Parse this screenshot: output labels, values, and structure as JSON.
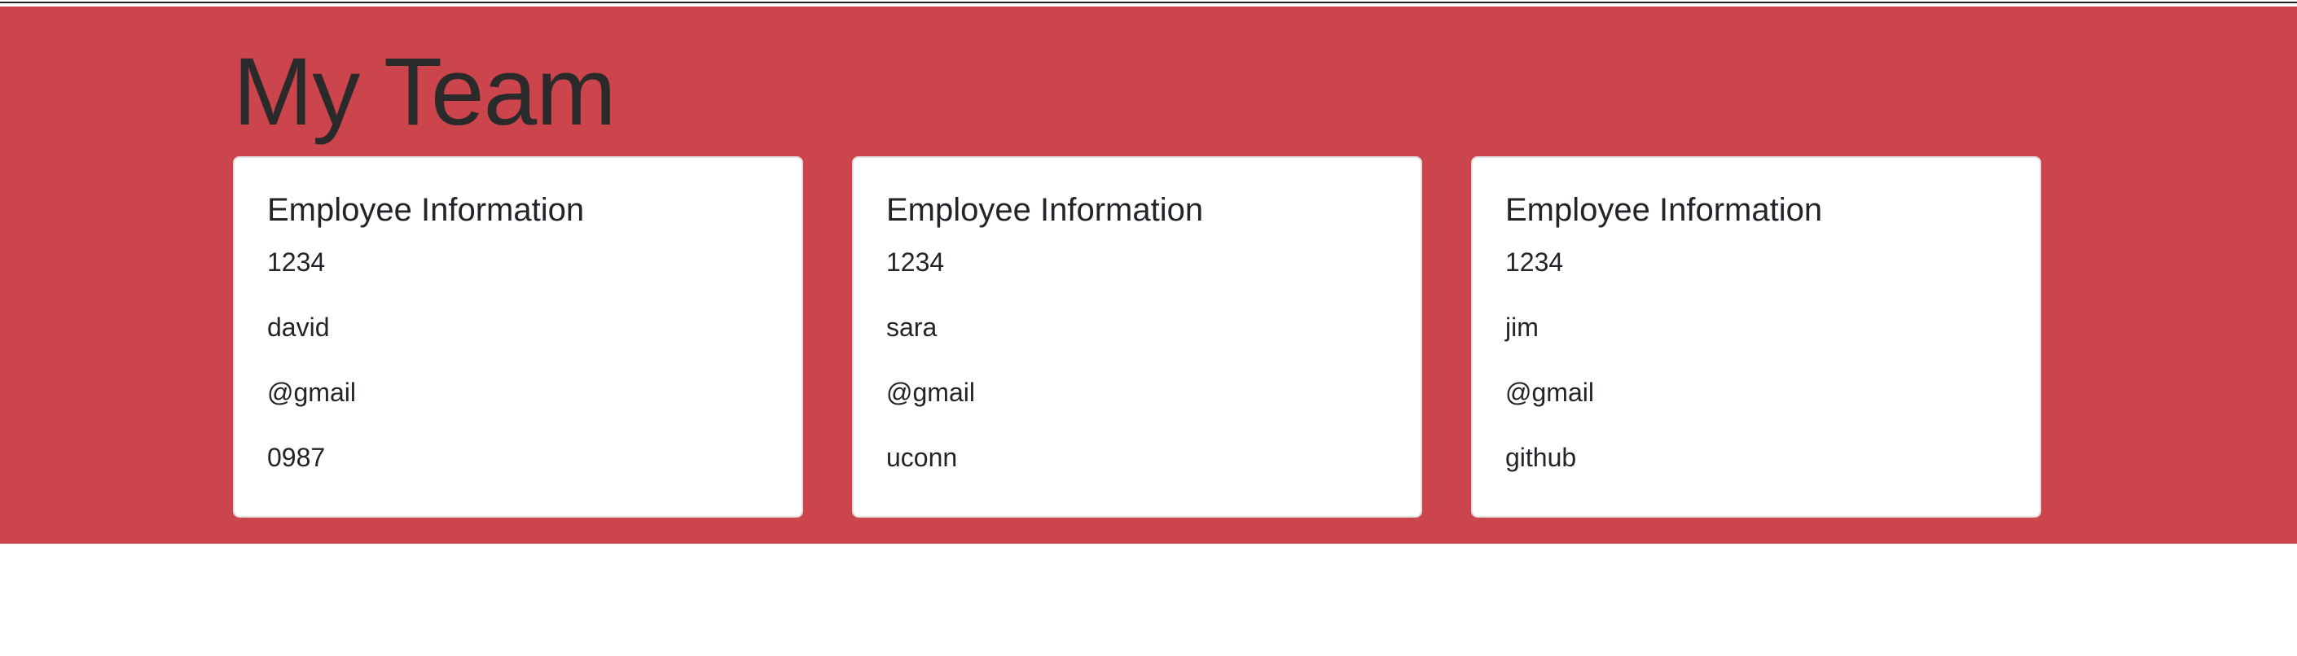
{
  "colors": {
    "hero_background": "#cd454c",
    "card_background": "#ffffff",
    "text": "#212529"
  },
  "header": {
    "title": "My Team"
  },
  "cards": [
    {
      "title": "Employee Information",
      "fields": [
        "1234",
        "david",
        "@gmail",
        "0987"
      ]
    },
    {
      "title": "Employee Information",
      "fields": [
        "1234",
        "sara",
        "@gmail",
        "uconn"
      ]
    },
    {
      "title": "Employee Information",
      "fields": [
        "1234",
        "jim",
        "@gmail",
        "github"
      ]
    }
  ]
}
